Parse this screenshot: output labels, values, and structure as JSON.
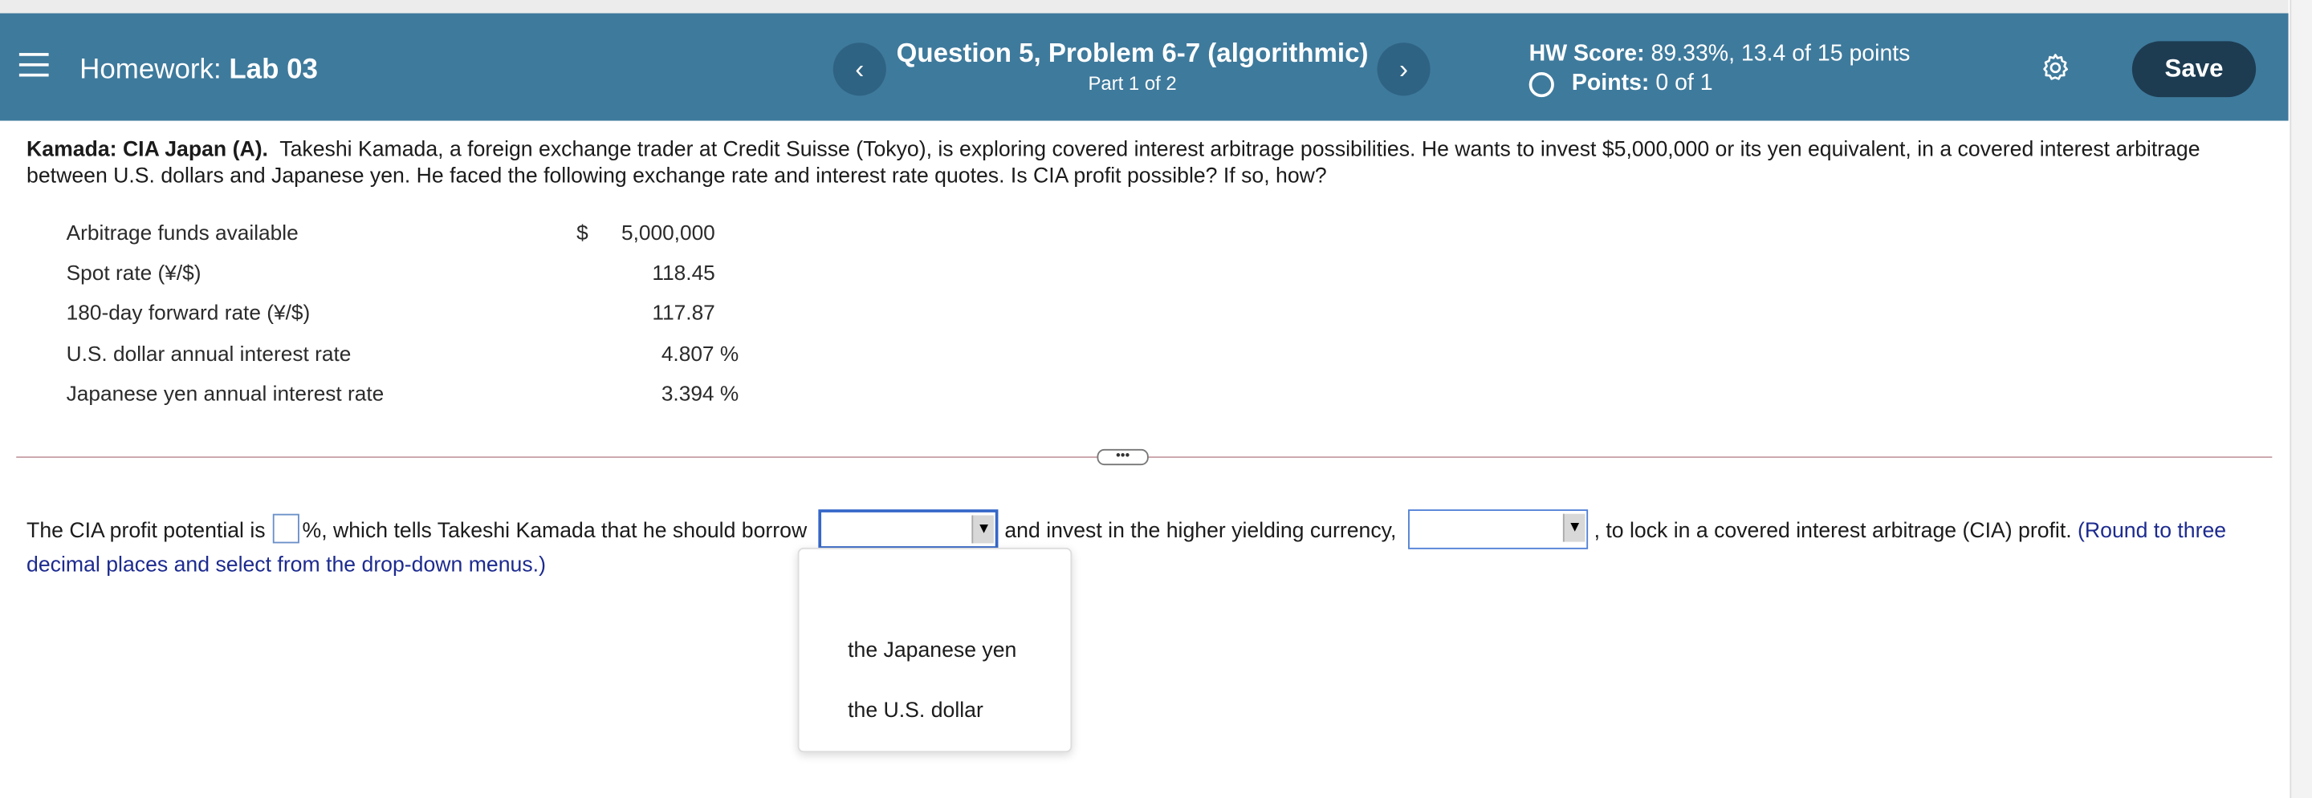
{
  "header": {
    "prefix": "Homework:",
    "assignment": "Lab 03",
    "question_title": "Question 5, Problem 6-7 (algorithmic)",
    "question_part": "Part 1 of 2",
    "hw_score_label": "HW Score:",
    "hw_score_value": "89.33%, 13.4 of 15 points",
    "points_label": "Points:",
    "points_value": "0 of 1",
    "save_label": "Save",
    "prev_glyph": "‹",
    "next_glyph": "›"
  },
  "question": {
    "title": "Kamada: CIA Japan (A).",
    "body": "Takeshi Kamada, a foreign exchange trader at Credit Suisse (Tokyo), is exploring covered interest arbitrage possibilities. He wants to invest $5,000,000 or its yen equivalent, in a covered interest arbitrage between U.S. dollars and Japanese yen. He faced the following exchange rate and interest rate quotes. Is CIA profit possible? If so, how?"
  },
  "table": {
    "currency_symbol": "$",
    "rows": [
      {
        "label": "Arbitrage funds available",
        "value": "5,000,000"
      },
      {
        "label": "Spot rate (¥/$)",
        "value": "118.45"
      },
      {
        "label": "180-day forward rate (¥/$)",
        "value": "117.87"
      },
      {
        "label": "U.S. dollar annual interest rate",
        "value": "4.807 %"
      },
      {
        "label": "Japanese yen annual interest rate",
        "value": "3.394 %"
      }
    ]
  },
  "expander_label": "•••",
  "answer": {
    "part1": "The CIA profit potential is",
    "part2": "%, which tells Takeshi Kamada that he should borrow",
    "part3": "and invest in the higher yielding currency,",
    "part4": ", to lock in a covered interest arbitrage (CIA) profit.",
    "hint": "(Round to three decimal places and select from the drop-down menus.)",
    "select_arrow": "▼",
    "options": [
      "the Japanese yen",
      "the U.S. dollar"
    ]
  }
}
